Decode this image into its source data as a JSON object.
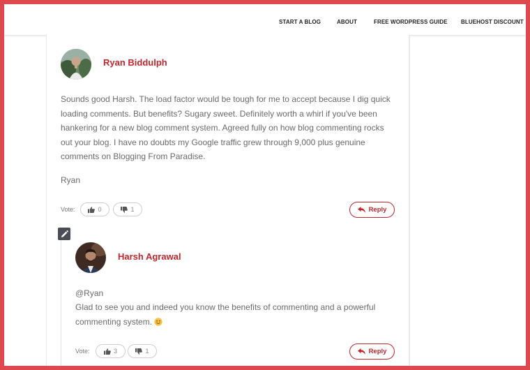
{
  "nav": {
    "items": [
      "START A BLOG",
      "ABOUT",
      "FREE WORDPRESS GUIDE",
      "BLUEHOST DISCOUNT"
    ]
  },
  "comments": [
    {
      "author": "Ryan Biddulph",
      "paragraphs": [
        "Sounds good Harsh. The load factor would be tough for me to accept because I dig quick loading comments. But benefits? Sugary sweet. Definitely worth a whirl if you've been hankering for a new blog comment system. Agreed fully on how blog commenting rocks out your blog. I have no doubts my Google traffic grew through 9,000 plus genuine comments on Blogging From Paradise.",
        "Ryan"
      ],
      "vote_label": "Vote:",
      "upvotes": "0",
      "downvotes": "1",
      "reply_label": "Reply"
    },
    {
      "author": "Harsh Agrawal",
      "mention": "@Ryan",
      "text": "Glad to see you and indeed you know the benefits of commenting and a powerful commenting system.",
      "vote_label": "Vote:",
      "upvotes": "3",
      "downvotes": "1",
      "reply_label": "Reply"
    }
  ],
  "colors": {
    "accent": "#c1272d",
    "frame": "#e0484f",
    "text": "#6a6a6a"
  },
  "icons": [
    "pencil-icon",
    "thumbs-up-icon",
    "thumbs-down-icon",
    "reply-arrow-icon",
    "smiley-emoji"
  ]
}
